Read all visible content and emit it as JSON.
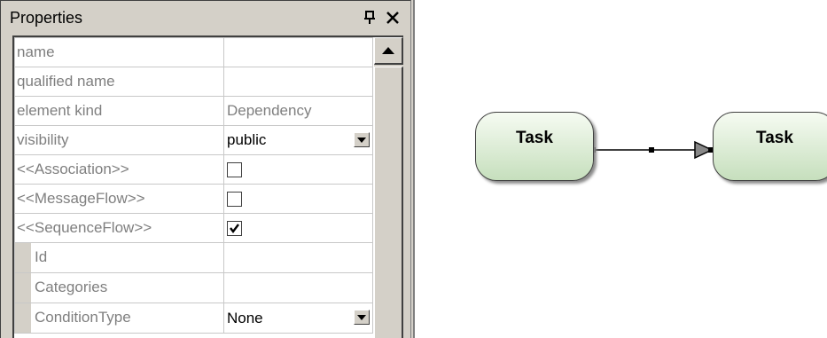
{
  "panel": {
    "title": "Properties",
    "pin_icon": "pin-icon",
    "close_icon": "close-icon"
  },
  "properties": [
    {
      "name": "name",
      "value": "",
      "type": "text"
    },
    {
      "name": "qualified name",
      "value": "",
      "type": "text"
    },
    {
      "name": "element kind",
      "value": "Dependency",
      "type": "readonly"
    },
    {
      "name": "visibility",
      "value": "public",
      "type": "dropdown"
    },
    {
      "name": "<<Association>>",
      "checked": false,
      "type": "checkbox"
    },
    {
      "name": "<<MessageFlow>>",
      "checked": false,
      "type": "checkbox"
    },
    {
      "name": "<<SequenceFlow>>",
      "checked": true,
      "type": "checkbox"
    },
    {
      "name": "Id",
      "value": "",
      "type": "text",
      "sub": true
    },
    {
      "name": "Categories",
      "value": "",
      "type": "text",
      "sub": true
    },
    {
      "name": "ConditionType",
      "value": "None",
      "type": "dropdown",
      "sub": true
    }
  ],
  "diagram": {
    "task_a_label": "Task",
    "task_b_label": "Task"
  }
}
